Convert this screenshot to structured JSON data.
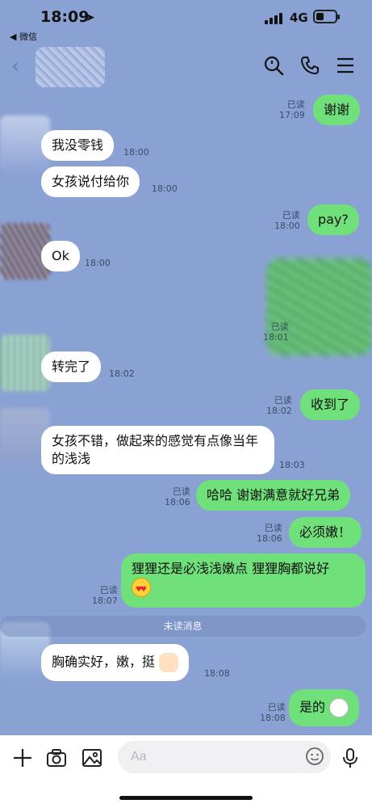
{
  "status": {
    "time": "18:09",
    "back_app": "◀ 微信",
    "network": "4G"
  },
  "header": {
    "icons": [
      "back-icon",
      "search-icon",
      "phone-icon",
      "menu-icon"
    ]
  },
  "messages": [
    {
      "dir": "out",
      "text": "谢谢",
      "read": "已读",
      "time": "17:09"
    },
    {
      "dir": "in",
      "text": "我没零钱",
      "time": "18:00"
    },
    {
      "dir": "in",
      "text": "女孩说付给你",
      "time": "18:00"
    },
    {
      "dir": "out",
      "text": "pay?",
      "read": "已读",
      "time": "18:00"
    },
    {
      "dir": "in",
      "text": "Ok",
      "time": "18:00"
    },
    {
      "dir": "out",
      "text": "",
      "read": "已读",
      "time": "18:01"
    },
    {
      "dir": "in",
      "text": "转完了",
      "time": "18:02"
    },
    {
      "dir": "out",
      "text": "收到了",
      "read": "已读",
      "time": "18:02"
    },
    {
      "dir": "in",
      "text": "女孩不错，做起来的感觉有点像当年的浅浅",
      "time": "18:03"
    },
    {
      "dir": "out",
      "text": "哈哈 谢谢满意就好兄弟",
      "read": "已读",
      "time": "18:06"
    },
    {
      "dir": "out",
      "text": "必须嫩！",
      "read": "已读",
      "time": "18:06"
    },
    {
      "dir": "out",
      "text": "狸狸还是必浅浅嫩点  狸狸胸都说好",
      "read": "已读",
      "time": "18:07",
      "emoji": "heart-eyes-icon"
    },
    {
      "dir": "in",
      "text": "胸确实好，嫩，挺",
      "time": "18:08",
      "emoji": "thumbs-up-icon"
    },
    {
      "dir": "out",
      "text": "是的",
      "read": "已读",
      "time": "18:08",
      "emoji": "bunny-sticker-icon"
    }
  ],
  "unread_label": "未读消息",
  "input": {
    "placeholder": "Aa",
    "icons": [
      "plus-icon",
      "camera-icon",
      "image-icon",
      "emoji-icon",
      "microphone-icon"
    ]
  },
  "colors": {
    "background": "#8aa2d3",
    "outgoing_bubble": "#6fe07a",
    "incoming_bubble": "#ffffff"
  }
}
